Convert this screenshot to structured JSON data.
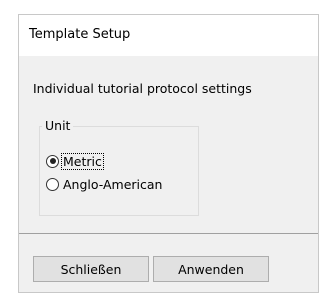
{
  "dialog": {
    "title": "Template Setup",
    "description": "Individual tutorial protocol settings",
    "unit_group": {
      "label": "Unit",
      "options": [
        {
          "label": "Metric",
          "selected": true
        },
        {
          "label": "Anglo-American",
          "selected": false
        }
      ]
    },
    "buttons": {
      "close_label": "Schließen",
      "apply_label": "Anwenden"
    }
  },
  "colors": {
    "dialog_background": "#f0f0f0",
    "title_background": "#ffffff",
    "button_background": "#e1e1e1",
    "button_border": "#adadad"
  }
}
